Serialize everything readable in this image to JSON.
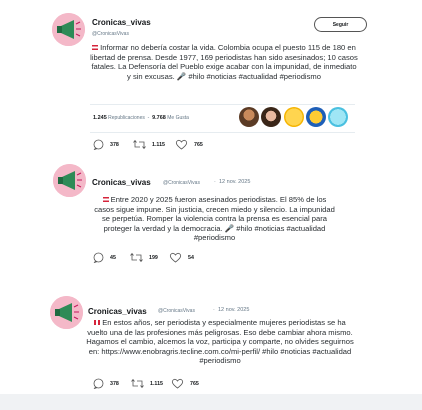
{
  "tweets": [
    {
      "name": "Cronicas_vivas",
      "handle": "@CronicasVivas",
      "follow_label": "Seguir",
      "text": "Informar no debería costar la vida. Colombia ocupa el puesto 115 de 180 en libertad de prensa. Desde 1977, 169 periodistas han sido asesinados; 10 casos fatales. La Defensoría del Pueblo exige acabar con la impunidad, de inmediato y sin excusas. 🎤 #hilo #noticias #actualidad #periodismo",
      "retweets_count": "1.245",
      "retweets_label": "Republicaciones",
      "likes_count": "9.768",
      "likes_label": "Me Gusta",
      "replies": "378",
      "reposts": "1.115",
      "favs": "765"
    },
    {
      "name": "Cronicas_vivas",
      "handle": "@CronicasVivas",
      "separator": "·",
      "date": "12 nov. 2025",
      "text": "Entre 2020 y 2025 fueron asesinados periodistas. El 85% de los casos sigue impune. Sin justicia, crecen miedo y silencio. La impunidad se perpetúa. Romper la violencia contra la prensa es esencial para proteger la verdad y la democracia. 🎤 #hilo #noticias #actualidad #periodismo",
      "replies": "45",
      "reposts": "199",
      "favs": "54"
    },
    {
      "name": "Cronicas_vivas",
      "handle": "@CronicasVivas",
      "separator": "·",
      "date": "12 nov. 2025",
      "text": "En estos años, ser periodista y especialmente mujeres periodistas se ha vuelto una de las profesiones más peligrosas. Eso debe cambiar ahora mismo. Hagamos el cambio, alcemos la voz, participa y comparte, no olvides seguirnos en: https://www.enobragris.tecline.com.co/mi-perfil/ #hilo #noticias #actualidad #periodismo",
      "replies": "378",
      "reposts": "1.115",
      "favs": "765"
    }
  ],
  "colors": {
    "accent": "#d5243b",
    "avatar_bg": "#f4b8c8",
    "megaphone": "#2e8b57"
  },
  "icons": [
    "reply-icon",
    "retweet-icon",
    "heart-icon",
    "megaphone-icon",
    "flag-icon"
  ]
}
